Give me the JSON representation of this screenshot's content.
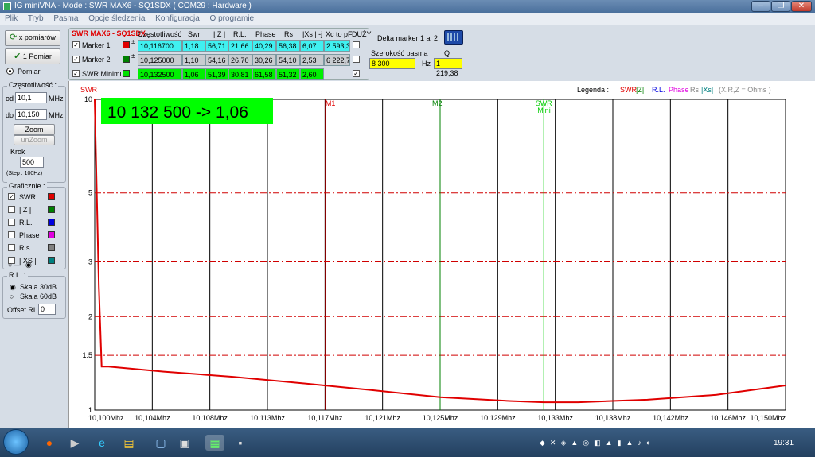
{
  "window": {
    "title": "IG miniVNA - Mode : SWR MAX6 - SQ1SDX ( COM29 :  Hardware )"
  },
  "menu": [
    "Plik",
    "Tryb",
    "Pasma",
    "Opcje śledzenia",
    "Konfiguracja",
    "O programie"
  ],
  "buttons": {
    "x_pomiarow": "x pomiarów",
    "pomiar1": "1 Pomiar",
    "pomiar_radio": "Pomiar",
    "zoom": "Zoom M1/M2",
    "unzoom": "unZoom"
  },
  "freq": {
    "title": "Częstotliwość :",
    "od_label": "od",
    "od_value": "10,1",
    "od_unit": "MHz",
    "do_label": "do",
    "do_value": "10,150",
    "do_unit": "MHz",
    "krok_label": "Krok",
    "krok_value": "500",
    "step_note": "(Step : 100Hz)"
  },
  "graph": {
    "title": "Graficznie :",
    "items": [
      {
        "label": "SWR",
        "checked": true,
        "color": "#e00000"
      },
      {
        "label": "| Z |",
        "checked": false,
        "color": "#008000"
      },
      {
        "label": "R.L.",
        "checked": false,
        "color": "#0000e0"
      },
      {
        "label": "Phase",
        "checked": false,
        "color": "#e000e0"
      },
      {
        "label": "R.s.",
        "checked": false,
        "color": "#808080"
      },
      {
        "label": "| XS |",
        "checked": false,
        "color": "#008080"
      }
    ]
  },
  "rl": {
    "title": "R.L. :",
    "opt1": "Skala 30dB",
    "opt2": "Skala 60dB",
    "offset_label": "Offset RL",
    "offset_value": "0"
  },
  "table": {
    "title": "SWR MAX6 - SQ1SDX",
    "headers": [
      "Częstotliwość",
      "Swr",
      "| Z |",
      "R.L.",
      "Phase",
      "Rs",
      "|Xs | -j",
      "Xc to pF",
      "DUŻY"
    ],
    "rows": [
      {
        "name": "Marker 1",
        "color": "#e00000",
        "values": [
          "10,116700",
          "1,18",
          "56,71",
          "21,66",
          "40,29",
          "56,38",
          "6,07",
          "2 593,3"
        ]
      },
      {
        "name": "Marker 2",
        "color": "#008000",
        "values": [
          "10,125000",
          "1,10",
          "54,16",
          "26,70",
          "30,26",
          "54,10",
          "2,53",
          "6 222,7"
        ]
      },
      {
        "name": "SWR Minimu",
        "color": "#00e000",
        "values": [
          "10,132500",
          "1,06",
          "51,39",
          "30,81",
          "61,58",
          "51,32",
          "2,60",
          ""
        ]
      }
    ]
  },
  "delta": {
    "title": "Delta marker 1 al 2",
    "bw_label": "Szerokość pasma",
    "bw_value": "8 300",
    "bw_unit": "Hz",
    "q_label": "Q",
    "q_value": "1 219,38"
  },
  "legend": {
    "label": "Legenda :",
    "swr": "SWR",
    "z": "|Z|",
    "rl": "R.L.",
    "phase": "Phase",
    "rs": "Rs",
    "xs": "|Xs|",
    "note": "(X,R,Z = Ohms )"
  },
  "readout": "10 132 500 -> 1,06",
  "markers": {
    "m1": "M1",
    "m2": "M2",
    "swrmin": "SWR",
    "swrmin2": "Mini"
  },
  "colors": {
    "swr": "#e00000",
    "green_box": "#00ff00",
    "cyan": "#40f0f0",
    "yellow": "#ffff00",
    "grid": "#000000",
    "dash": "#d00000"
  },
  "taskbar": {
    "clock": "19:31"
  },
  "chart_data": {
    "type": "line",
    "ylabel": "SWR",
    "ylim": [
      1,
      10
    ],
    "yscale": "log",
    "y_ticks": [
      "10",
      "5",
      "3",
      "2",
      "1.5",
      "1"
    ],
    "x_ticks": [
      "10,100Mhz",
      "10,104Mhz",
      "10,108Mhz",
      "10,113Mhz",
      "10,117Mhz",
      "10,121Mhz",
      "10,125Mhz",
      "10,129Mhz",
      "10,133Mhz",
      "10,138Mhz",
      "10,142Mhz",
      "10,146Mhz",
      "10,150Mhz"
    ],
    "xlim": [
      10.1,
      10.15
    ],
    "dashed_levels": [
      5,
      3,
      2,
      1.5
    ],
    "markers": [
      {
        "label": "M1",
        "x": 10.1167
      },
      {
        "label": "M2",
        "x": 10.125
      },
      {
        "label": "SWR Mini",
        "x": 10.1325
      }
    ],
    "series": [
      {
        "name": "SWR",
        "x": [
          10.1,
          10.1003,
          10.1005,
          10.101,
          10.105,
          10.11,
          10.115,
          10.12,
          10.125,
          10.13,
          10.1325,
          10.135,
          10.14,
          10.145,
          10.15
        ],
        "y": [
          10,
          2.5,
          1.38,
          1.38,
          1.33,
          1.28,
          1.22,
          1.16,
          1.1,
          1.07,
          1.06,
          1.06,
          1.08,
          1.12,
          1.2
        ]
      }
    ]
  }
}
